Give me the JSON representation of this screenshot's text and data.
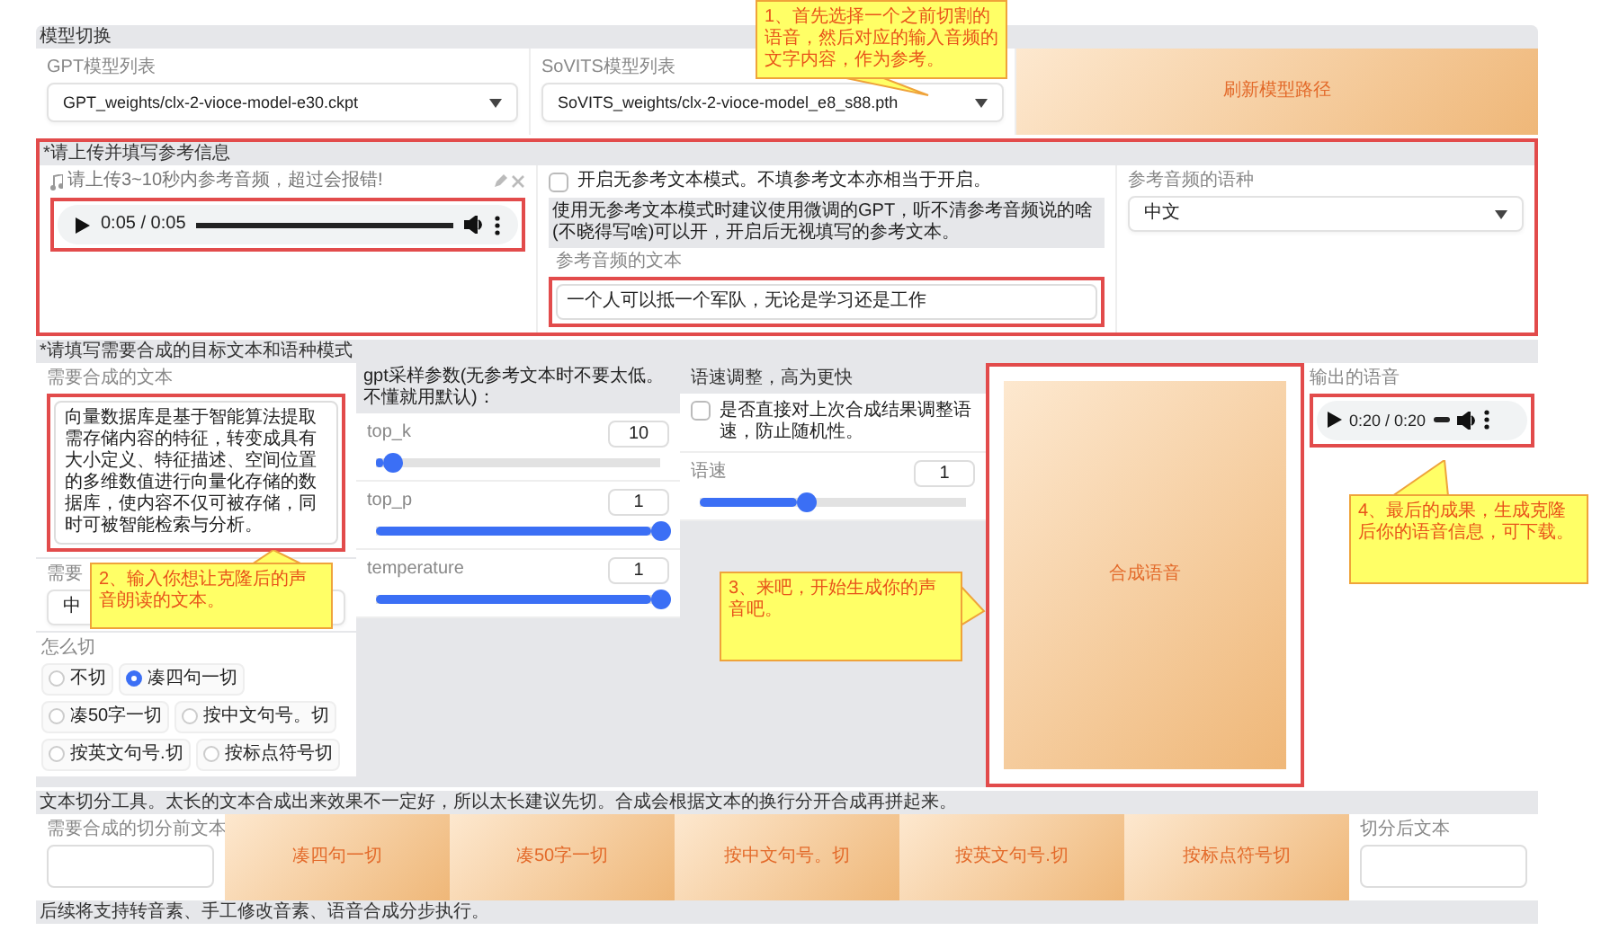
{
  "model_switch": {
    "title": "模型切换",
    "gpt_model": {
      "label": "GPT模型列表",
      "value": "GPT_weights/clx-2-vioce-model-e30.ckpt"
    },
    "sovits_model": {
      "label": "SoVITS模型列表",
      "value": "SoVITS_weights/clx-2-vioce-model_e8_s88.pth"
    },
    "refresh_button": "刷新模型路径"
  },
  "reference": {
    "title": "*请上传并填写参考信息",
    "highlighted": true,
    "audio": {
      "label": "请上传3~10秒内参考音频，超过会报错!",
      "time": "0:05 / 0:05",
      "level": 1,
      "highlighted": true
    },
    "no_ref_mode": {
      "label": "开启无参考文本模式。不填参考文本亦相当于开启。",
      "checked": false
    },
    "note": "使用无参考文本模式时建议使用微调的GPT，听不清参考音频说的啥(不晓得写啥)可以开，开启后无视填写的参考文本。",
    "ref_text": {
      "label": "参考音频的文本",
      "value": "一个人可以抵一个军队，无论是学习还是工作",
      "highlighted": true
    },
    "language": {
      "label": "参考音频的语种",
      "value": "中文"
    }
  },
  "synthesis": {
    "title": "*请填写需要合成的目标文本和语种模式",
    "target_text": {
      "label": "需要合成的文本",
      "value": "向量数据库是基于智能算法提取需存储内容的特征，转变成具有大小定义、特征描述、空间位置的多维数值进行向量化存储的数据库，使内容不仅可被存储，同时可被智能检索与分析。",
      "highlighted": true
    },
    "target_language": {
      "label": "需要",
      "value": "中"
    },
    "split": {
      "label": "怎么切",
      "options": [
        {
          "label": "不切",
          "selected": false
        },
        {
          "label": "凑四句一切",
          "selected": true
        },
        {
          "label": "凑50字一切",
          "selected": false
        },
        {
          "label": "按中文句号。切",
          "selected": false
        },
        {
          "label": "按英文句号.切",
          "selected": false
        },
        {
          "label": "按标点符号切",
          "selected": false
        }
      ]
    },
    "gpt_params": {
      "title": "gpt采样参数(无参考文本时不要太低。不懂就用默认)：",
      "sliders": [
        {
          "label": "top_k",
          "value": "10",
          "level": 0.06
        },
        {
          "label": "top_p",
          "value": "1",
          "level": 1
        },
        {
          "label": "temperature",
          "value": "1",
          "level": 1
        }
      ]
    },
    "speed": {
      "title": "语速调整，高为更快",
      "adjust_last": {
        "label": "是否直接对上次合成结果调整语速，防止随机性。",
        "checked": false
      },
      "slider": {
        "label": "语速",
        "value": "1",
        "level": 0.4
      }
    },
    "generate_button": {
      "label": "合成语音",
      "highlighted": true
    },
    "output": {
      "label": "输出的语音",
      "time": "0:20 / 0:20",
      "highlighted": true
    }
  },
  "split_tool": {
    "title": "文本切分工具。太长的文本合成出来效果不一定好，所以太长建议先切。合成会根据文本的换行分开合成再拼起来。",
    "input": {
      "label": "需要合成的切分前文本"
    },
    "buttons": [
      "凑四句一切",
      "凑50字一切",
      "按中文句号。切",
      "按英文句号.切",
      "按标点符号切"
    ],
    "output": {
      "label": "切分后文本"
    }
  },
  "footer": "后续将支持转音素、手工修改音素、语音合成分步执行。",
  "callouts": [
    {
      "text": "1、首先选择一个之前切割的语音，然后对应的输入音频的文字内容，作为参考。"
    },
    {
      "text": "2、输入你想让克隆后的声音朗读的文本。"
    },
    {
      "text": "3、来吧，开始生成你的声音吧。"
    },
    {
      "text": "4、最后的成果，生成克隆后你的语音信息，可下载。"
    }
  ]
}
